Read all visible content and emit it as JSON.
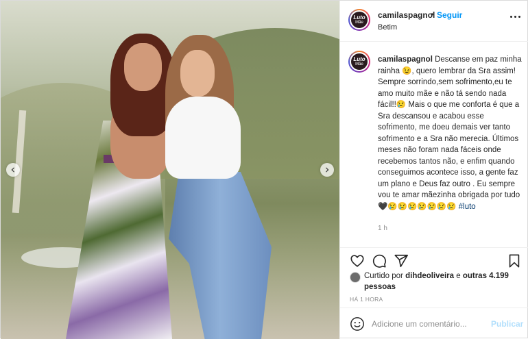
{
  "post": {
    "author": {
      "username": "camilaspagnol",
      "avatar_text_line1": "Luto",
      "avatar_text_line2": "Mãe",
      "separator": "•",
      "follow_label": "Seguir",
      "location": "Betim"
    },
    "caption": {
      "username": "camilaspagnol",
      "text": " Descanse em paz minha rainha 😉, quero lembrar da Sra assim! Sempre sorrindo,sem sofrimento,eu te amo muito mãe e não tá sendo nada fácil!!😢 Mais o que me conforta é que a Sra descansou e acabou esse sofrimento, me doeu demais ver tanto sofrimento e a Sra não merecia. Últimos meses não foram nada fáceis onde recebemos tantos não, e enfim quando conseguimos acontece isso, a gente faz um plano e Deus faz outro . Eu sempre vou te amar mãezinha obrigada por tudo 🖤😢😢😢😢😢😢😢 ",
      "hashtag": "#luto",
      "time": "1 h"
    },
    "likes": {
      "prefix": "Curtido por ",
      "user": "dihdeoliveira",
      "middle": " e ",
      "count_text": "outras 4.199 pessoas"
    },
    "posted_ago": "HÁ 1 HORA",
    "comment_box": {
      "placeholder": "Adicione um comentário...",
      "publish_label": "Publicar"
    },
    "icons": {
      "like": "heart-icon",
      "comment": "comment-icon",
      "share": "share-icon",
      "save": "bookmark-icon",
      "emoji": "emoji-icon",
      "more": "more-options-icon",
      "prev": "chevron-left-icon",
      "next": "chevron-right-icon"
    },
    "colors": {
      "follow": "#0095f6",
      "publish_disabled": "#b2dffc",
      "hashtag": "#00376b",
      "muted": "#8e8e8e"
    }
  }
}
